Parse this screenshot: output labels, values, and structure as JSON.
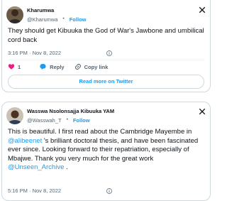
{
  "tweets": [
    {
      "display_name": "Kharumwa",
      "handle": "@Kharumwa",
      "follow_label": "Follow",
      "text": "They should get Kibuuka the God of War's Jawbone and umbilical cord back",
      "timestamp": "3:16 PM · Nov 8, 2022",
      "likes": "1",
      "reply_label": "Reply",
      "copy_label": "Copy link",
      "read_more_label": "Read more on Twitter"
    },
    {
      "display_name": "Wasswa Nsolonsajja Kibuuka YAM",
      "handle": "@Wasswah_T",
      "follow_label": "Follow",
      "text_parts": {
        "p1": "This is beautiful. I first read about the Cambridge Mayembe in ",
        "mention1": "@alibeenet",
        "p2": " 's brilliant doctoral thesis, and have been fascinated ever since. Looking forward to their repatriation, especially of Mbajwe.  Thank you very much for the great work ",
        "mention2": "@Unseen_Archive",
        "p3": " ."
      },
      "timestamp": "5:16 PM · Nov 8, 2022"
    }
  ],
  "colors": {
    "accent": "#1d9bf0",
    "like": "#f91880",
    "muted": "#536471"
  },
  "icons": [
    "x-logo-icon",
    "info-icon",
    "heart-icon",
    "reply-icon",
    "link-icon"
  ]
}
